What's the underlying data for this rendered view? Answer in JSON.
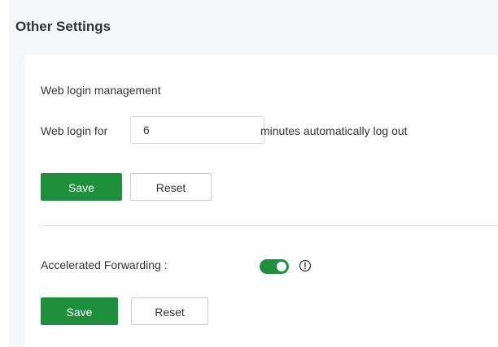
{
  "header": {
    "title": "Other Settings"
  },
  "web_login": {
    "section_title": "Web login management",
    "row_label": "Web login for",
    "minutes_value": "6",
    "row_suffix": "minutes automatically log out",
    "save_label": "Save",
    "reset_label": "Reset"
  },
  "accelerated": {
    "label": "Accelerated Forwarding :",
    "toggle_on": true,
    "info_icon": "info-circle-icon",
    "save_label": "Save",
    "reset_label": "Reset"
  },
  "colors": {
    "accent": "#1e8f3a",
    "panel_bg": "#f5f6f8",
    "text": "#333333",
    "divider": "#e3e5e8"
  }
}
